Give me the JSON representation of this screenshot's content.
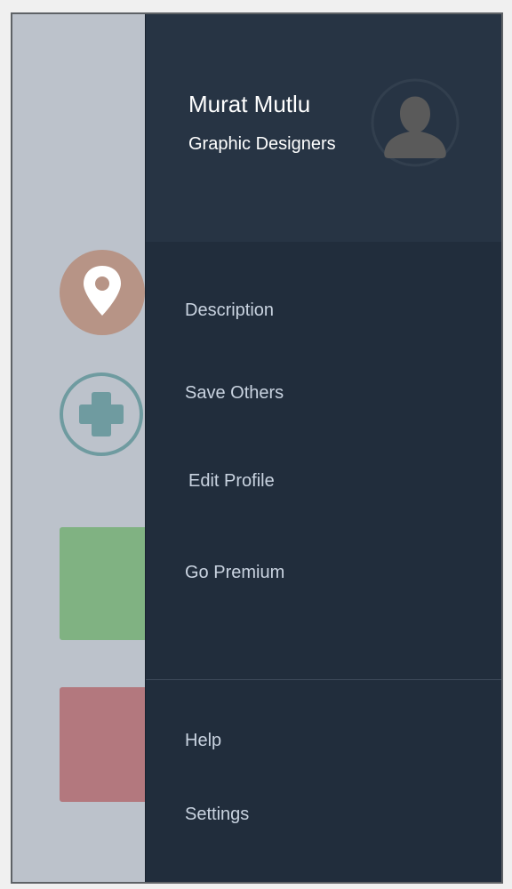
{
  "profile": {
    "name": "Murat Mutlu",
    "role": "Graphic Designers",
    "avatar_icon": "user-silhouette-icon"
  },
  "menu": {
    "primary": [
      {
        "label": "Description"
      },
      {
        "label": "Save Others"
      },
      {
        "label": "Edit Profile"
      },
      {
        "label": "Go Premium"
      }
    ],
    "secondary": [
      {
        "label": "Help"
      },
      {
        "label": "Settings"
      }
    ]
  },
  "background": {
    "icons": [
      "location-pin-icon",
      "medical-cross-icon"
    ]
  },
  "colors": {
    "drawer_bg": "#212d3c",
    "header_bg": "#273444",
    "menu_text": "#c9d3e0",
    "location_circle": "#b79486",
    "medical_ring": "#6f9ba0",
    "card_green": "#80b282",
    "card_red": "#b3787e"
  }
}
